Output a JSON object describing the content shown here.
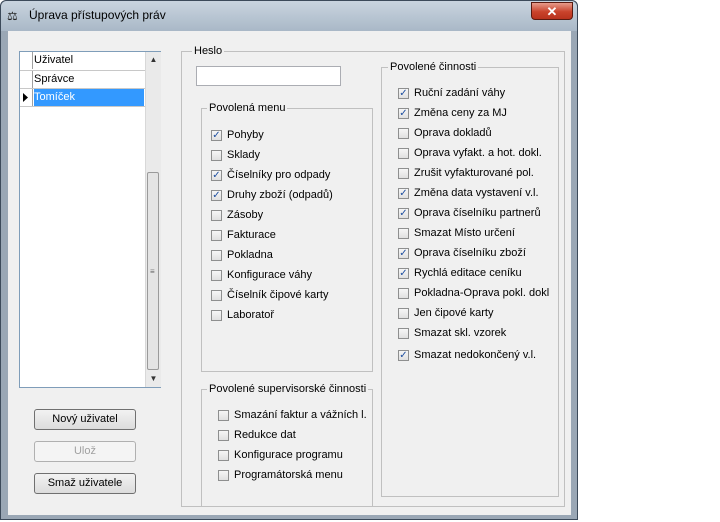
{
  "window": {
    "title": "Úprava přístupových práv",
    "close_glyph": "✕",
    "icon": "scales-icon"
  },
  "users": {
    "header": "Uživatel",
    "rows": [
      {
        "name": "Správce",
        "selected": false
      },
      {
        "name": "Tomíček",
        "selected": true
      }
    ]
  },
  "buttons": {
    "new_user": "Nový uživatel",
    "save": "Ulož",
    "delete_user": "Smaž uživatele"
  },
  "password": {
    "label": "Heslo",
    "value": ""
  },
  "menus": {
    "title": "Povolená menu",
    "items": [
      {
        "label": "Pohyby",
        "checked": true
      },
      {
        "label": "Sklady",
        "checked": false
      },
      {
        "label": "Číselníky pro odpady",
        "checked": true
      },
      {
        "label": "Druhy zboží (odpadů)",
        "checked": true
      },
      {
        "label": "Zásoby",
        "checked": false
      },
      {
        "label": "Fakturace",
        "checked": false
      },
      {
        "label": "Pokladna",
        "checked": false
      },
      {
        "label": "Konfigurace váhy",
        "checked": false
      },
      {
        "label": "Číselník čipové karty",
        "checked": false
      },
      {
        "label": "Laboratoř",
        "checked": false
      }
    ]
  },
  "supervisor": {
    "title": "Povolené supervisorské činnosti",
    "items": [
      {
        "label": "Smazání faktur a vážních l.",
        "checked": false
      },
      {
        "label": "Redukce dat",
        "checked": false
      },
      {
        "label": "Konfigurace programu",
        "checked": false
      },
      {
        "label": "Programátorská menu",
        "checked": false
      }
    ]
  },
  "activities": {
    "title": "Povolené činnosti",
    "items": [
      {
        "label": "Ruční zadání váhy",
        "checked": true
      },
      {
        "label": "Změna ceny za MJ",
        "checked": true
      },
      {
        "label": "Oprava dokladů",
        "checked": false
      },
      {
        "label": "Oprava vyfakt. a hot. dokl.",
        "checked": false
      },
      {
        "label": "Zrušit vyfakturované pol.",
        "checked": false
      },
      {
        "label": "Změna data vystavení v.l.",
        "checked": true
      },
      {
        "label": "Oprava číselníku partnerů",
        "checked": true
      },
      {
        "label": "Smazat Místo určení",
        "checked": false
      },
      {
        "label": "Oprava číselníku zboží",
        "checked": true
      },
      {
        "label": "Rychlá editace ceníku",
        "checked": true
      },
      {
        "label": "Pokladna-Oprava pokl. dokl",
        "checked": false
      },
      {
        "label": "Jen čipové karty",
        "checked": false
      },
      {
        "label": "Smazat skl. vzorek",
        "checked": false
      },
      {
        "label": "Smazat nedokončený v.l.",
        "checked": true
      }
    ]
  }
}
